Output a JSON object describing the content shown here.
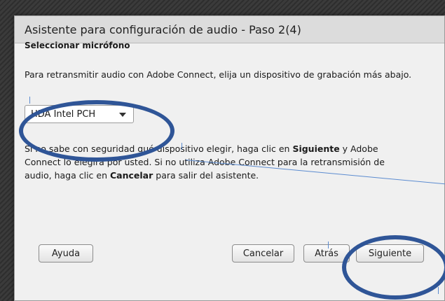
{
  "dialog": {
    "title": "Asistente para configuración de audio - Paso 2(4)",
    "heading": "Seleccionar micrófono",
    "intro": "Para retransmitir audio con Adobe Connect, elija un dispositivo de grabación más abajo.",
    "device_selected": "HDA Intel PCH",
    "help_1": "Si no sabe con seguridad qué dispositivo elegir, haga clic en ",
    "help_next": "Siguiente",
    "help_2": " y Adobe Connect lo elegirá por usted. Si no utiliza Adobe Connect para la retransmisión de audio, haga clic en ",
    "help_cancel": "Cancelar",
    "help_3": " para salir del asistente."
  },
  "buttons": {
    "help": "Ayuda",
    "cancel": "Cancelar",
    "back": "Atrás",
    "next": "Siguiente"
  },
  "colors": {
    "annotation_ellipse": "#2f5597",
    "annotation_line": "#5b8bd0"
  }
}
